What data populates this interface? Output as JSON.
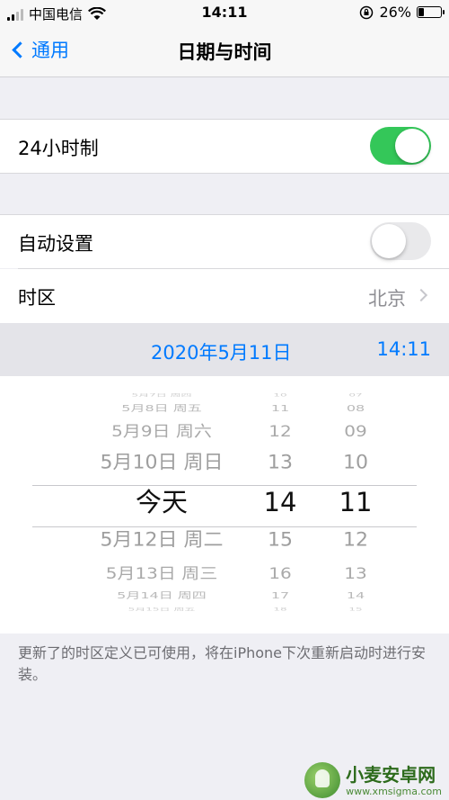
{
  "status": {
    "carrier": "中国电信",
    "time": "14:11",
    "battery": "26%",
    "battery_level": 0.26,
    "icons": [
      "signal-icon",
      "wifi-icon",
      "orientation-lock-icon",
      "battery-icon"
    ]
  },
  "nav": {
    "back_label": "通用",
    "title": "日期与时间"
  },
  "settings": {
    "h24_label": "24小时制",
    "h24_on": true,
    "auto_label": "自动设置",
    "auto_on": false,
    "timezone_label": "时区",
    "timezone_value": "北京"
  },
  "selected": {
    "date": "2020年5月11日",
    "time": "14:11"
  },
  "picker": {
    "rows": [
      {
        "date": "5月7日 周四",
        "hour": "10",
        "min": "07"
      },
      {
        "date": "5月8日 周五",
        "hour": "11",
        "min": "08"
      },
      {
        "date": "5月9日 周六",
        "hour": "12",
        "min": "09"
      },
      {
        "date": "5月10日 周日",
        "hour": "13",
        "min": "10"
      },
      {
        "date": "今天",
        "hour": "14",
        "min": "11"
      },
      {
        "date": "5月12日 周二",
        "hour": "15",
        "min": "12"
      },
      {
        "date": "5月13日 周三",
        "hour": "16",
        "min": "13"
      },
      {
        "date": "5月14日 周四",
        "hour": "17",
        "min": "14"
      },
      {
        "date": "5月15日 周五",
        "hour": "18",
        "min": "15"
      }
    ]
  },
  "footer_note": "更新了的时区定义已可使用，将在iPhone下次重新启动时进行安装。",
  "watermark": {
    "name": "小麦安卓网",
    "url": "www.xmsigma.com"
  },
  "colors": {
    "accent": "#007aff",
    "toggle_on": "#34c759",
    "toggle_off": "#e9e9eb",
    "background": "#efeff4"
  }
}
